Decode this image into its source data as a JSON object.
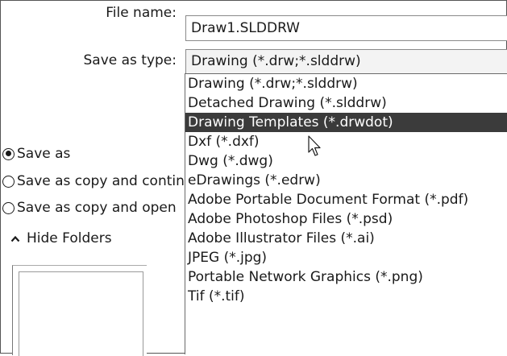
{
  "file_name": {
    "label": "File name:",
    "value": "Draw1.SLDDRW"
  },
  "save_as_type": {
    "label": "Save as type:",
    "selected": "Drawing (*.drw;*.slddrw)",
    "options": [
      "Drawing (*.drw;*.slddrw)",
      "Detached Drawing (*.slddrw)",
      "Drawing Templates (*.drwdot)",
      "Dxf (*.dxf)",
      "Dwg (*.dwg)",
      "eDrawings (*.edrw)",
      "Adobe Portable Document Format (*.pdf)",
      "Adobe Photoshop Files (*.psd)",
      "Adobe Illustrator Files (*.ai)",
      "JPEG (*.jpg)",
      "Portable Network Graphics (*.png)",
      "Tif (*.tif)"
    ],
    "highlighted_index": 2
  },
  "save_options": [
    {
      "label": "Save as",
      "checked": true
    },
    {
      "label": "Save as copy and continue",
      "checked": false
    },
    {
      "label": "Save as copy and open",
      "checked": false
    }
  ],
  "hide_folders": {
    "label": "Hide Folders",
    "icon": "chevron-up-icon"
  },
  "cursor": {
    "icon": "mouse-pointer-icon"
  }
}
